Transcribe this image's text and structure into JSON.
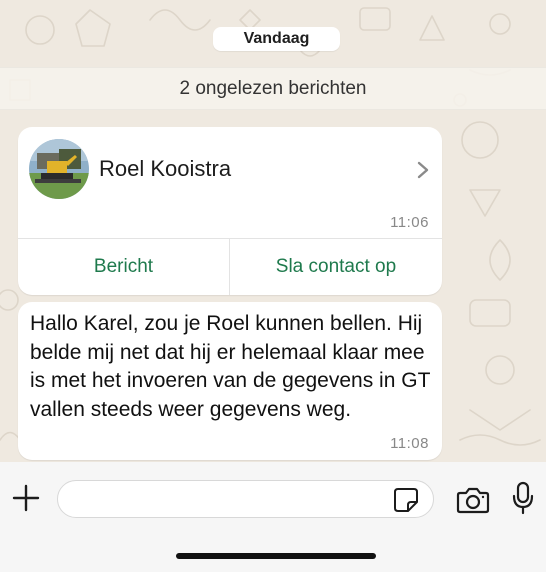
{
  "chat": {
    "date_label": "Vandaag",
    "unread_label": "2 ongelezen berichten"
  },
  "contact_card": {
    "name": "Roel Kooistra",
    "time": "11:06",
    "message_button": "Bericht",
    "save_contact_button": "Sla contact op",
    "avatar_icon": "contact-photo-excavator",
    "accent_color": "#1f7a4d"
  },
  "message": {
    "text": "Hallo Karel, zou je Roel kunnen bellen. Hij belde mij net dat hij er helemaal klaar mee is met het invoeren van de gegevens in GT vallen steeds weer gegevens weg.",
    "time": "11:08"
  },
  "composer": {
    "input_value": "",
    "icons": [
      "plus-icon",
      "sticker-icon",
      "camera-icon",
      "microphone-icon"
    ]
  }
}
